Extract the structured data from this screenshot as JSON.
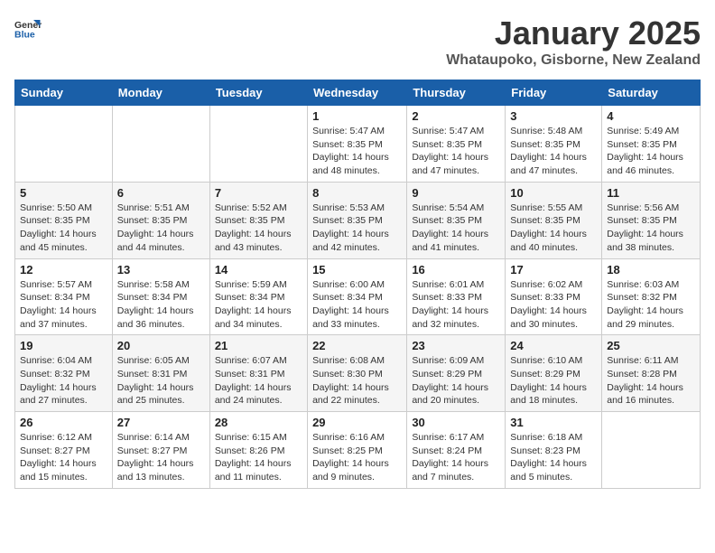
{
  "logo": {
    "general": "General",
    "blue": "Blue"
  },
  "title": "January 2025",
  "location": "Whataupoko, Gisborne, New Zealand",
  "weekdays": [
    "Sunday",
    "Monday",
    "Tuesday",
    "Wednesday",
    "Thursday",
    "Friday",
    "Saturday"
  ],
  "weeks": [
    [
      {
        "day": "",
        "info": ""
      },
      {
        "day": "",
        "info": ""
      },
      {
        "day": "",
        "info": ""
      },
      {
        "day": "1",
        "info": "Sunrise: 5:47 AM\nSunset: 8:35 PM\nDaylight: 14 hours\nand 48 minutes."
      },
      {
        "day": "2",
        "info": "Sunrise: 5:47 AM\nSunset: 8:35 PM\nDaylight: 14 hours\nand 47 minutes."
      },
      {
        "day": "3",
        "info": "Sunrise: 5:48 AM\nSunset: 8:35 PM\nDaylight: 14 hours\nand 47 minutes."
      },
      {
        "day": "4",
        "info": "Sunrise: 5:49 AM\nSunset: 8:35 PM\nDaylight: 14 hours\nand 46 minutes."
      }
    ],
    [
      {
        "day": "5",
        "info": "Sunrise: 5:50 AM\nSunset: 8:35 PM\nDaylight: 14 hours\nand 45 minutes."
      },
      {
        "day": "6",
        "info": "Sunrise: 5:51 AM\nSunset: 8:35 PM\nDaylight: 14 hours\nand 44 minutes."
      },
      {
        "day": "7",
        "info": "Sunrise: 5:52 AM\nSunset: 8:35 PM\nDaylight: 14 hours\nand 43 minutes."
      },
      {
        "day": "8",
        "info": "Sunrise: 5:53 AM\nSunset: 8:35 PM\nDaylight: 14 hours\nand 42 minutes."
      },
      {
        "day": "9",
        "info": "Sunrise: 5:54 AM\nSunset: 8:35 PM\nDaylight: 14 hours\nand 41 minutes."
      },
      {
        "day": "10",
        "info": "Sunrise: 5:55 AM\nSunset: 8:35 PM\nDaylight: 14 hours\nand 40 minutes."
      },
      {
        "day": "11",
        "info": "Sunrise: 5:56 AM\nSunset: 8:35 PM\nDaylight: 14 hours\nand 38 minutes."
      }
    ],
    [
      {
        "day": "12",
        "info": "Sunrise: 5:57 AM\nSunset: 8:34 PM\nDaylight: 14 hours\nand 37 minutes."
      },
      {
        "day": "13",
        "info": "Sunrise: 5:58 AM\nSunset: 8:34 PM\nDaylight: 14 hours\nand 36 minutes."
      },
      {
        "day": "14",
        "info": "Sunrise: 5:59 AM\nSunset: 8:34 PM\nDaylight: 14 hours\nand 34 minutes."
      },
      {
        "day": "15",
        "info": "Sunrise: 6:00 AM\nSunset: 8:34 PM\nDaylight: 14 hours\nand 33 minutes."
      },
      {
        "day": "16",
        "info": "Sunrise: 6:01 AM\nSunset: 8:33 PM\nDaylight: 14 hours\nand 32 minutes."
      },
      {
        "day": "17",
        "info": "Sunrise: 6:02 AM\nSunset: 8:33 PM\nDaylight: 14 hours\nand 30 minutes."
      },
      {
        "day": "18",
        "info": "Sunrise: 6:03 AM\nSunset: 8:32 PM\nDaylight: 14 hours\nand 29 minutes."
      }
    ],
    [
      {
        "day": "19",
        "info": "Sunrise: 6:04 AM\nSunset: 8:32 PM\nDaylight: 14 hours\nand 27 minutes."
      },
      {
        "day": "20",
        "info": "Sunrise: 6:05 AM\nSunset: 8:31 PM\nDaylight: 14 hours\nand 25 minutes."
      },
      {
        "day": "21",
        "info": "Sunrise: 6:07 AM\nSunset: 8:31 PM\nDaylight: 14 hours\nand 24 minutes."
      },
      {
        "day": "22",
        "info": "Sunrise: 6:08 AM\nSunset: 8:30 PM\nDaylight: 14 hours\nand 22 minutes."
      },
      {
        "day": "23",
        "info": "Sunrise: 6:09 AM\nSunset: 8:29 PM\nDaylight: 14 hours\nand 20 minutes."
      },
      {
        "day": "24",
        "info": "Sunrise: 6:10 AM\nSunset: 8:29 PM\nDaylight: 14 hours\nand 18 minutes."
      },
      {
        "day": "25",
        "info": "Sunrise: 6:11 AM\nSunset: 8:28 PM\nDaylight: 14 hours\nand 16 minutes."
      }
    ],
    [
      {
        "day": "26",
        "info": "Sunrise: 6:12 AM\nSunset: 8:27 PM\nDaylight: 14 hours\nand 15 minutes."
      },
      {
        "day": "27",
        "info": "Sunrise: 6:14 AM\nSunset: 8:27 PM\nDaylight: 14 hours\nand 13 minutes."
      },
      {
        "day": "28",
        "info": "Sunrise: 6:15 AM\nSunset: 8:26 PM\nDaylight: 14 hours\nand 11 minutes."
      },
      {
        "day": "29",
        "info": "Sunrise: 6:16 AM\nSunset: 8:25 PM\nDaylight: 14 hours\nand 9 minutes."
      },
      {
        "day": "30",
        "info": "Sunrise: 6:17 AM\nSunset: 8:24 PM\nDaylight: 14 hours\nand 7 minutes."
      },
      {
        "day": "31",
        "info": "Sunrise: 6:18 AM\nSunset: 8:23 PM\nDaylight: 14 hours\nand 5 minutes."
      },
      {
        "day": "",
        "info": ""
      }
    ]
  ]
}
